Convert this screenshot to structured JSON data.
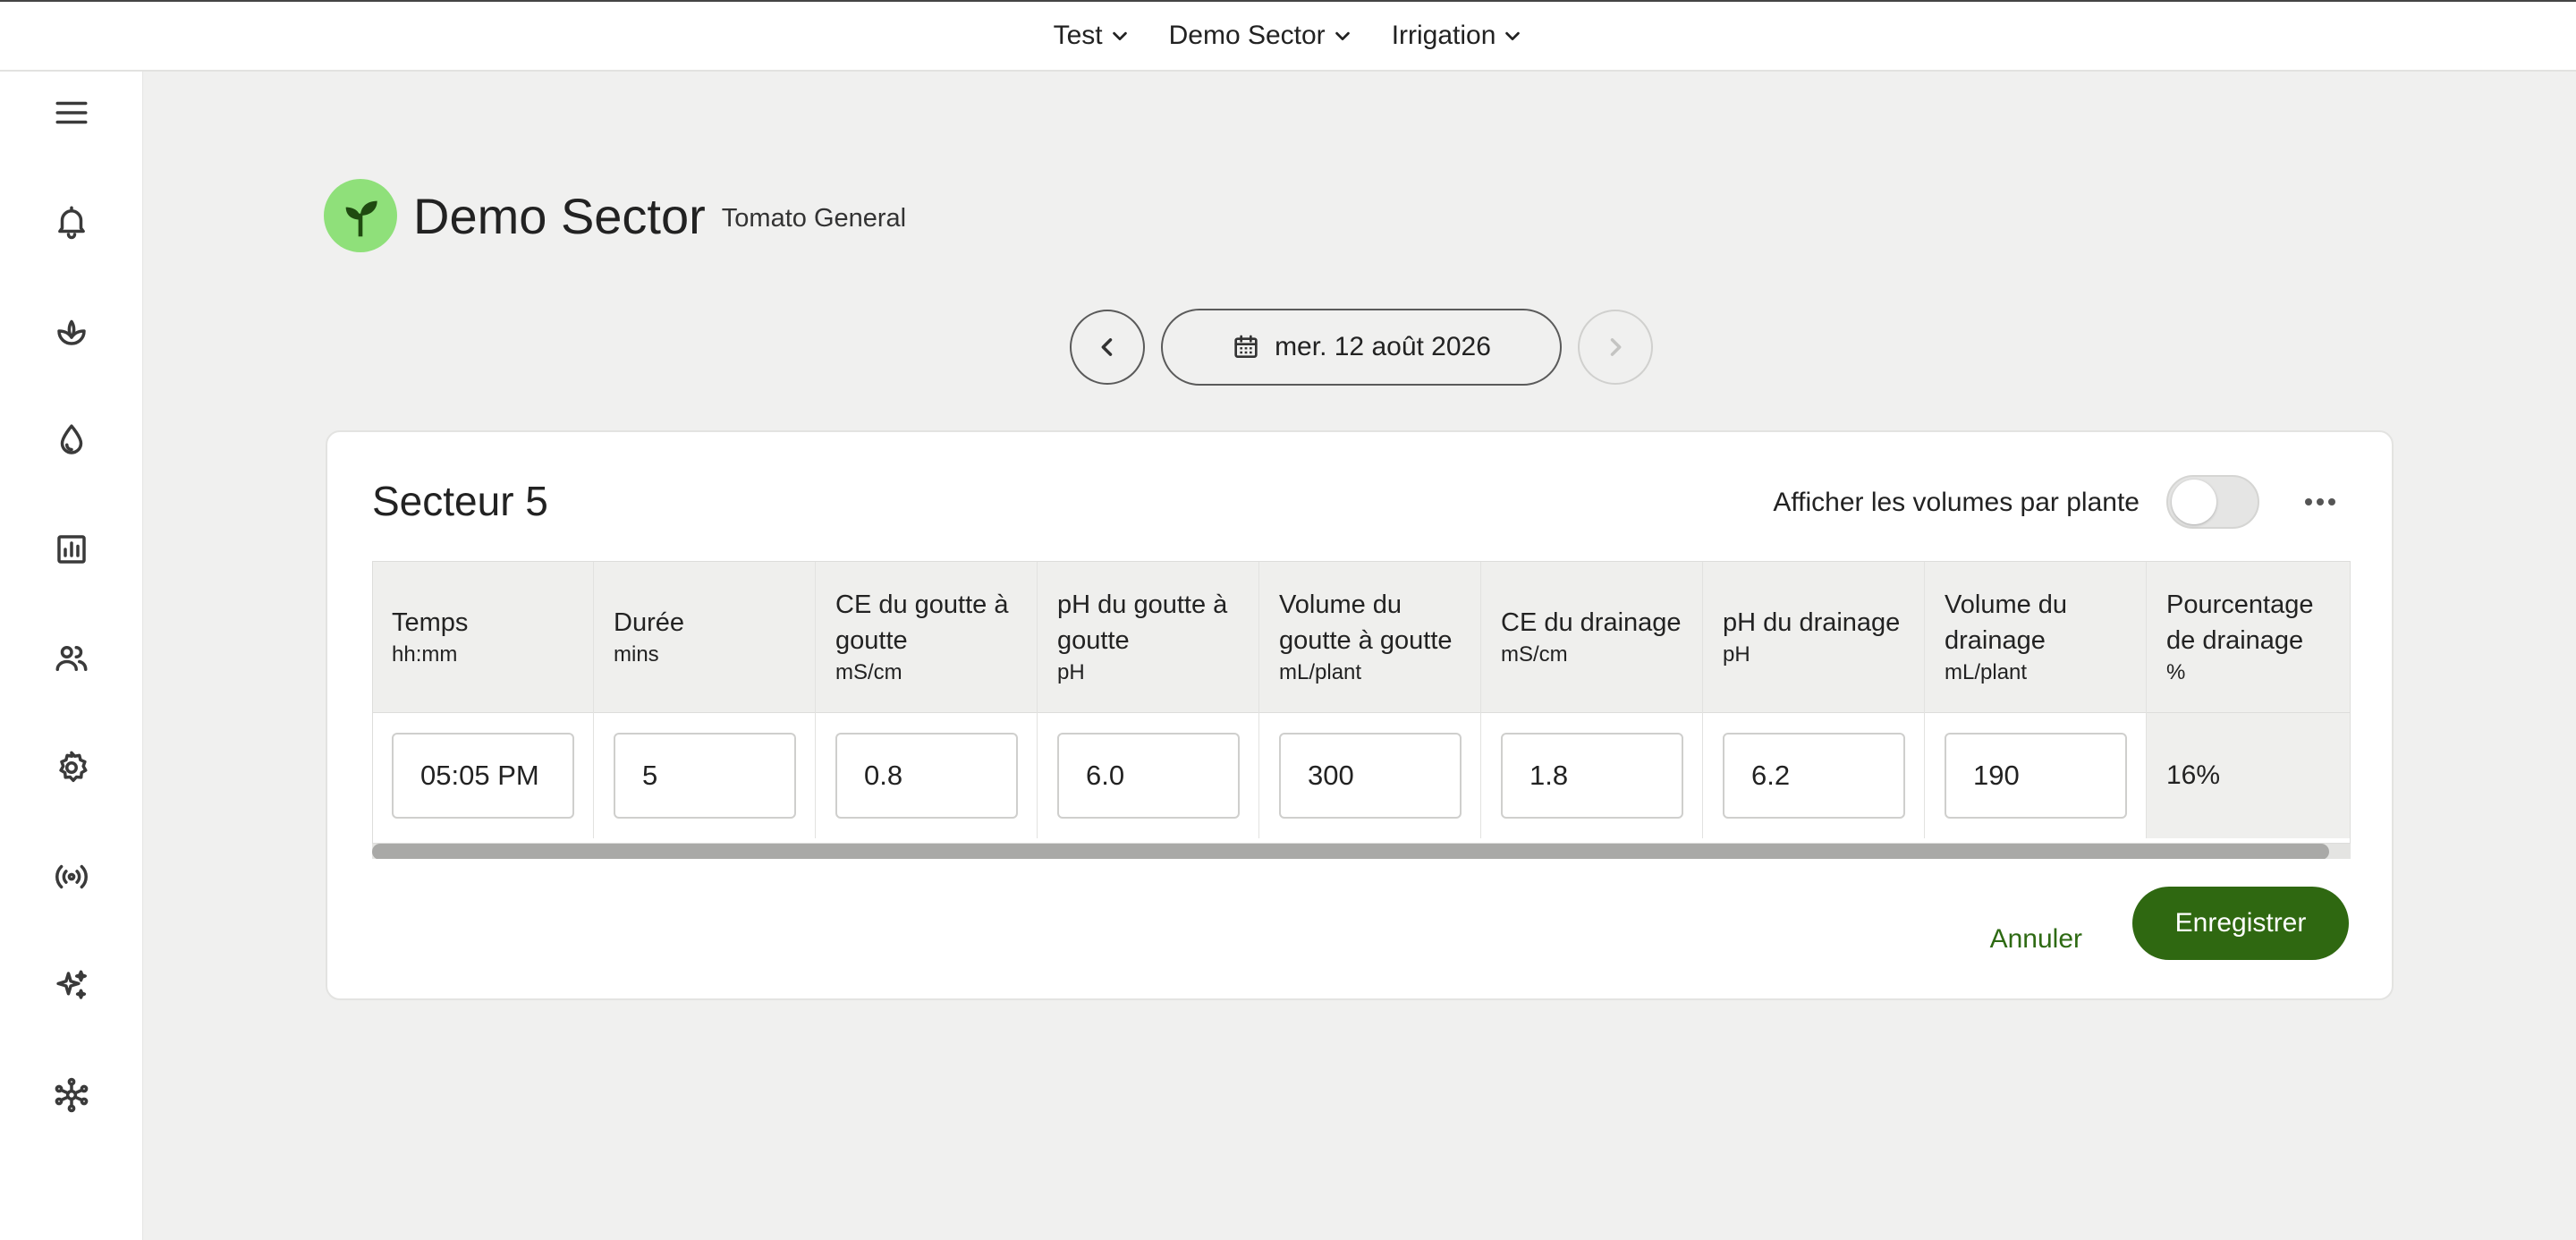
{
  "topbar": {
    "crumbs": [
      {
        "label": "Test"
      },
      {
        "label": "Demo Sector"
      },
      {
        "label": "Irrigation"
      }
    ]
  },
  "sidebar": {
    "items": [
      {
        "icon": "menu-icon"
      },
      {
        "icon": "bell-icon"
      },
      {
        "icon": "plant-icon"
      },
      {
        "icon": "water-drop-icon"
      },
      {
        "icon": "chart-icon"
      },
      {
        "icon": "users-icon"
      },
      {
        "icon": "gear-icon"
      },
      {
        "icon": "broadcast-icon"
      },
      {
        "icon": "sparkles-icon"
      },
      {
        "icon": "network-icon"
      }
    ]
  },
  "header": {
    "title": "Demo Sector",
    "subtitle": "Tomato General",
    "avatar_color": "#8fe07a"
  },
  "datenav": {
    "date": "mer. 12 août 2026"
  },
  "card": {
    "title": "Secteur 5",
    "toggle_label": "Afficher les volumes par plante",
    "toggle_on": false
  },
  "table": {
    "columns": [
      {
        "name": "Temps",
        "unit": "hh:mm"
      },
      {
        "name": "Durée",
        "unit": "mins"
      },
      {
        "name": "CE du goutte à goutte",
        "unit": "mS/cm"
      },
      {
        "name": "pH du goutte à goutte",
        "unit": "pH"
      },
      {
        "name": "Volume du goutte à goutte",
        "unit": "mL/plant"
      },
      {
        "name": "CE du drainage",
        "unit": "mS/cm"
      },
      {
        "name": "pH du drainage",
        "unit": "pH"
      },
      {
        "name": "Volume du drainage",
        "unit": "mL/plant"
      },
      {
        "name": "Pourcentage de drainage",
        "unit": "%"
      }
    ],
    "row": {
      "time": "05:05 PM",
      "duration": "5",
      "drip_ec": "0.8",
      "drip_ph": "6.0",
      "drip_volume": "300",
      "drain_ec": "1.8",
      "drain_ph": "6.2",
      "drain_volume": "190",
      "drain_percent": "16%"
    }
  },
  "actions": {
    "cancel_label": "Annuler",
    "save_label": "Enregistrer",
    "accent": "#2f6811"
  }
}
